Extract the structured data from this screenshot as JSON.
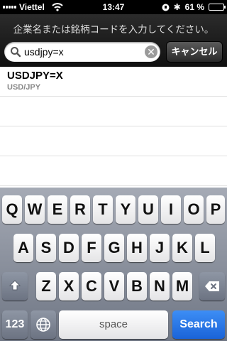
{
  "status_bar": {
    "carrier": "Viettel",
    "time": "13:47",
    "battery_percent": "61 %",
    "battery_level": 0.61
  },
  "search": {
    "prompt": "企業名または銘柄コードを入力してください。",
    "query": "usdjpy=x",
    "cancel_label": "キャンセル"
  },
  "results": [
    {
      "symbol": "USDJPY=X",
      "name": "USD/JPY"
    }
  ],
  "keyboard": {
    "row1": [
      "Q",
      "W",
      "E",
      "R",
      "T",
      "Y",
      "U",
      "I",
      "O",
      "P"
    ],
    "row2": [
      "A",
      "S",
      "D",
      "F",
      "G",
      "H",
      "J",
      "K",
      "L"
    ],
    "row3": [
      "Z",
      "X",
      "C",
      "V",
      "B",
      "N",
      "M"
    ],
    "numbers_label": "123",
    "space_label": "space",
    "search_label": "Search"
  }
}
